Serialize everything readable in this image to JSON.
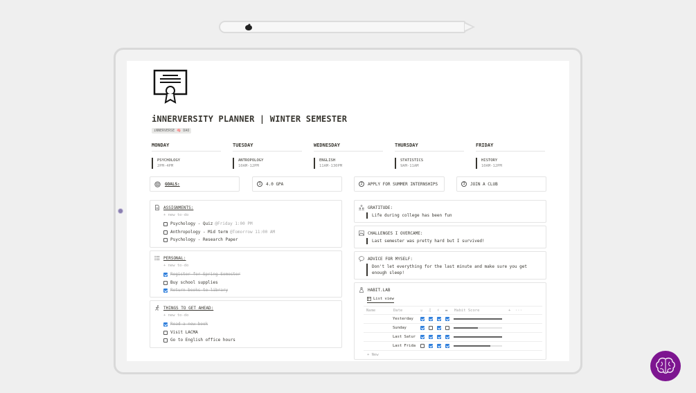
{
  "page": {
    "title": "iNNERVERSITY PLANNER | WINTER SEMESTER",
    "tag": "iNNERVERSE 🧠 DAO"
  },
  "days": [
    {
      "name": "MONDAY",
      "class": "PSYCHOLOGY",
      "time": "2PM-4PM"
    },
    {
      "name": "TUESDAY",
      "class": "ANTROPOLOGY",
      "time": "10AM-12PM"
    },
    {
      "name": "WEDNESDAY",
      "class": "ENGLISH",
      "time": "11AM-130PM"
    },
    {
      "name": "THURSDAY",
      "class": "STATISTICS",
      "time": "9AM-11AM"
    },
    {
      "name": "FRIDAY",
      "class": "HISTORY",
      "time": "10AM-12PM"
    }
  ],
  "goals": {
    "title": "GOALS:",
    "items": [
      {
        "num": "1",
        "text": "4.0 GPA"
      },
      {
        "num": "2",
        "text": "APPLY FOR SUMMER INTERNSHIPS"
      },
      {
        "num": "3",
        "text": "JOIN A CLUB"
      }
    ]
  },
  "assignments": {
    "title": "ASSIGNMENTS:",
    "new_todo": "+ new to-do",
    "items": [
      {
        "text": "Psychology - Quiz",
        "due": "@Friday 1:00 PM",
        "done": false
      },
      {
        "text": "Anthropology - Mid term",
        "due": "@Tomorrow 11:00 AM",
        "done": false
      },
      {
        "text": "Psychology - Research Paper",
        "due": "",
        "done": false
      }
    ]
  },
  "personal": {
    "title": "PERSONAL:",
    "new_todo": "+ new to-do",
    "items": [
      {
        "text": "Register for Spring Semester",
        "done": true
      },
      {
        "text": "Buy school supplies",
        "done": false
      },
      {
        "text": "Return books to library",
        "done": true
      }
    ]
  },
  "ahead": {
    "title": "THINGS TO GET AHEAD:",
    "new_todo": "+ new to-do",
    "items": [
      {
        "text": "Read a new book",
        "done": true
      },
      {
        "text": "Visit LACMA",
        "done": false
      },
      {
        "text": "Go to English office hours",
        "done": false
      }
    ]
  },
  "reflections": [
    {
      "title": "GRATITUDE:",
      "icon": "people-icon",
      "text": "Life during college has been fun"
    },
    {
      "title": "CHALLENGES I OVERCAME:",
      "icon": "mountain-icon",
      "text": "Last semester was pretty hard but I survived!"
    },
    {
      "title": "ADVICE FOR MYSELF:",
      "icon": "speech-bubble-icon",
      "text": "Don't let everything for the last minute and make sure you get enough sleep!"
    }
  ],
  "habit": {
    "title": "HABIT.LAB",
    "view": "List view",
    "columns": {
      "name": "Name",
      "date": "Date",
      "score": "Habit Score",
      "add": "+",
      "more": "···"
    },
    "rows": [
      {
        "date": "Yesterday",
        "checks": [
          true,
          true,
          true,
          true
        ],
        "score": 1.0
      },
      {
        "date": "Sunday",
        "checks": [
          true,
          false,
          true,
          false
        ],
        "score": 0.5
      },
      {
        "date": "Last Satur",
        "checks": [
          true,
          true,
          true,
          true
        ],
        "score": 1.0
      },
      {
        "date": "Last Frida",
        "checks": [
          false,
          true,
          true,
          true
        ],
        "score": 0.75
      }
    ],
    "new": "+ New"
  },
  "colors": {
    "accent": "#2f7fdc",
    "badge": "#7d1590"
  }
}
